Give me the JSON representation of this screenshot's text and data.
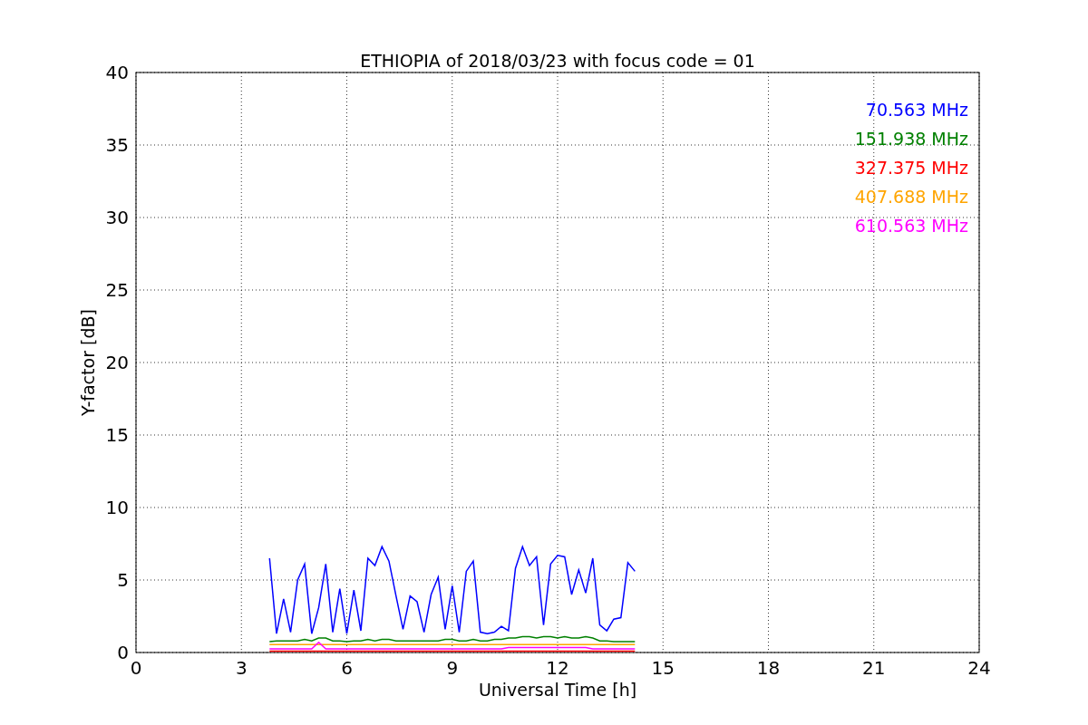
{
  "chart_data": {
    "type": "line",
    "title": "ETHIOPIA of 2018/03/23 with focus code = 01",
    "xlabel": "Universal Time [h]",
    "ylabel": "Y-factor [dB]",
    "x": [
      3.8,
      4.0,
      4.2,
      4.4,
      4.6,
      4.8,
      5.0,
      5.2,
      5.4,
      5.6,
      5.8,
      6.0,
      6.2,
      6.4,
      6.6,
      6.8,
      7.0,
      7.2,
      7.4,
      7.6,
      7.8,
      8.0,
      8.2,
      8.4,
      8.6,
      8.8,
      9.0,
      9.2,
      9.4,
      9.6,
      9.8,
      10.0,
      10.2,
      10.4,
      10.6,
      10.8,
      11.0,
      11.2,
      11.4,
      11.6,
      11.8,
      12.0,
      12.2,
      12.4,
      12.6,
      12.8,
      13.0,
      13.2,
      13.4,
      13.6,
      13.8,
      14.0,
      14.2
    ],
    "series": [
      {
        "name": "70.563 MHz",
        "color": "#0000ff",
        "values": [
          6.5,
          1.3,
          3.7,
          1.4,
          5.0,
          6.1,
          1.3,
          3.1,
          6.1,
          1.4,
          4.4,
          1.3,
          4.3,
          1.5,
          6.5,
          6.0,
          7.3,
          6.3,
          3.9,
          1.6,
          3.9,
          3.5,
          1.4,
          4.0,
          5.2,
          1.6,
          4.6,
          1.4,
          5.6,
          6.3,
          1.4,
          1.3,
          1.4,
          1.8,
          1.5,
          5.8,
          7.3,
          6.0,
          6.6,
          1.9,
          6.1,
          6.7,
          6.6,
          4.0,
          5.7,
          4.1,
          6.5,
          1.9,
          1.5,
          2.3,
          2.4,
          6.2,
          5.6
        ]
      },
      {
        "name": "151.938 MHz",
        "color": "#008000",
        "values": [
          0.75,
          0.8,
          0.8,
          0.8,
          0.8,
          0.9,
          0.8,
          1.0,
          1.0,
          0.8,
          0.8,
          0.75,
          0.8,
          0.8,
          0.9,
          0.8,
          0.9,
          0.9,
          0.8,
          0.8,
          0.8,
          0.8,
          0.8,
          0.8,
          0.8,
          0.9,
          0.9,
          0.8,
          0.8,
          0.9,
          0.8,
          0.8,
          0.9,
          0.9,
          1.0,
          1.0,
          1.1,
          1.1,
          1.0,
          1.1,
          1.1,
          1.0,
          1.1,
          1.0,
          1.0,
          1.1,
          1.0,
          0.8,
          0.8,
          0.75,
          0.75,
          0.75,
          0.75
        ]
      },
      {
        "name": "327.375 MHz",
        "color": "#ff0000",
        "values": [
          0.1,
          0.1,
          0.1,
          0.1,
          0.1,
          0.1,
          0.1,
          0.1,
          0.1,
          0.1,
          0.1,
          0.1,
          0.1,
          0.1,
          0.1,
          0.1,
          0.1,
          0.1,
          0.1,
          0.1,
          0.1,
          0.1,
          0.1,
          0.1,
          0.1,
          0.1,
          0.1,
          0.1,
          0.1,
          0.1,
          0.1,
          0.1,
          0.1,
          0.1,
          0.1,
          0.1,
          0.1,
          0.1,
          0.1,
          0.1,
          0.1,
          0.1,
          0.1,
          0.1,
          0.1,
          0.1,
          0.1,
          0.1,
          0.1,
          0.1,
          0.1,
          0.1,
          0.1
        ]
      },
      {
        "name": "407.688 MHz",
        "color": "#ffa500",
        "values": [
          0.55,
          0.55,
          0.55,
          0.55,
          0.55,
          0.55,
          0.55,
          0.55,
          0.55,
          0.55,
          0.55,
          0.55,
          0.55,
          0.55,
          0.55,
          0.55,
          0.55,
          0.55,
          0.55,
          0.55,
          0.55,
          0.55,
          0.55,
          0.55,
          0.55,
          0.55,
          0.55,
          0.55,
          0.55,
          0.55,
          0.55,
          0.55,
          0.55,
          0.55,
          0.55,
          0.55,
          0.55,
          0.55,
          0.55,
          0.55,
          0.55,
          0.55,
          0.55,
          0.55,
          0.55,
          0.55,
          0.55,
          0.55,
          0.55,
          0.55,
          0.55,
          0.55,
          0.55
        ]
      },
      {
        "name": "610.563 MHz",
        "color": "#ff00ff",
        "values": [
          0.25,
          0.25,
          0.25,
          0.25,
          0.25,
          0.25,
          0.25,
          0.7,
          0.25,
          0.25,
          0.25,
          0.25,
          0.25,
          0.25,
          0.25,
          0.25,
          0.25,
          0.25,
          0.25,
          0.25,
          0.25,
          0.25,
          0.25,
          0.25,
          0.25,
          0.25,
          0.25,
          0.25,
          0.25,
          0.25,
          0.25,
          0.25,
          0.25,
          0.25,
          0.35,
          0.35,
          0.35,
          0.35,
          0.35,
          0.35,
          0.35,
          0.35,
          0.35,
          0.35,
          0.35,
          0.35,
          0.25,
          0.25,
          0.25,
          0.25,
          0.25,
          0.25,
          0.25
        ]
      }
    ],
    "xlim": [
      0,
      24
    ],
    "ylim": [
      0,
      40
    ],
    "grid": true,
    "xticks": [
      0,
      3,
      6,
      9,
      12,
      15,
      18,
      21,
      24
    ],
    "yticks": [
      0,
      5,
      10,
      15,
      20,
      25,
      30,
      35,
      40
    ]
  }
}
